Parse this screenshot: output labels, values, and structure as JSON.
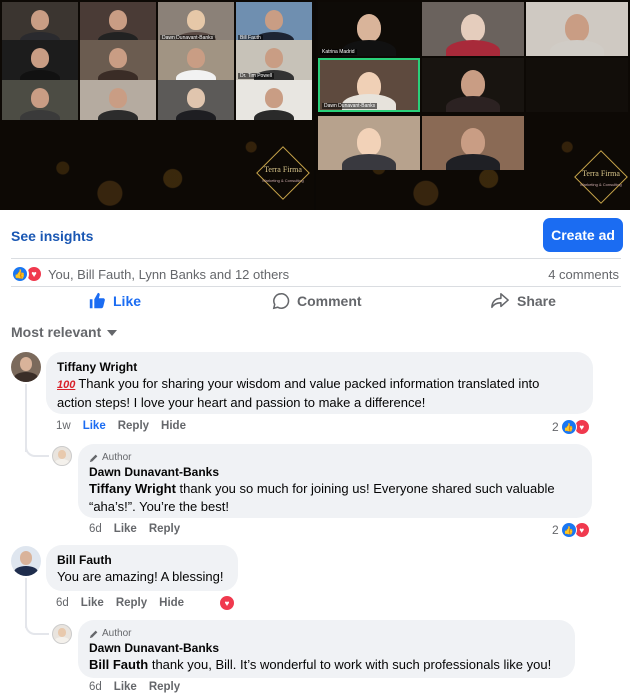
{
  "gallery": {
    "left_tiles": [
      "",
      "",
      "Dawn Dunavant-Banks",
      "Bill Fauth",
      "",
      "",
      "",
      "",
      "",
      "",
      "Dr. Tim Powell",
      "",
      "",
      "",
      "",
      ""
    ],
    "right_tiles": [
      "",
      "Katrina Madrid",
      "",
      "",
      "Dawn Dunavant-Banks",
      "",
      "",
      "",
      "",
      "",
      "",
      ""
    ],
    "logo_name": "Terra Firma",
    "logo_sub": "Marketing & Consulting"
  },
  "post_actions": {
    "see_insights": "See insights",
    "create_ad": "Create ad"
  },
  "reactions": {
    "names": "You, Bill Fauth, Lynn Banks and 12 others",
    "comments_count": "4 comments"
  },
  "actions": {
    "like": "Like",
    "comment": "Comment",
    "share": "Share"
  },
  "sort": {
    "label": "Most relevant"
  },
  "comments": [
    {
      "name": "Tiffany Wright",
      "emoji": "100",
      "text": "Thank you for sharing your wisdom and value packed information translated into",
      "text2": "action steps! I love your heart and passion to make a difference!",
      "time": "1w",
      "like": "Like",
      "reply": "Reply",
      "hide": "Hide",
      "reaction_count": "2",
      "reply_item": {
        "author_tag": "Author",
        "name": "Dawn Dunavant-Banks",
        "mention": "Tiffany Wright",
        "text": "thank you so much for joining us! Everyone shared such valuable",
        "text2": "“aha’s!”. You’re the best!",
        "time": "6d",
        "like": "Like",
        "reply": "Reply",
        "reaction_count": "2"
      }
    },
    {
      "name": "Bill Fauth",
      "text": "You are amazing! A blessing!",
      "time": "6d",
      "like": "Like",
      "reply": "Reply",
      "hide": "Hide",
      "reply_item": {
        "author_tag": "Author",
        "name": "Dawn Dunavant-Banks",
        "mention": "Bill Fauth",
        "text": "thank you, Bill. It’s wonderful to work with such professionals like you!",
        "time": "6d",
        "like": "Like",
        "reply": "Reply"
      }
    }
  ],
  "colors": {
    "accent": "#1b6cf2",
    "like_reaction": "#1a77f2",
    "love_reaction": "#f0394e",
    "bubble": "#f0f2f5",
    "muted": "#65676b"
  }
}
